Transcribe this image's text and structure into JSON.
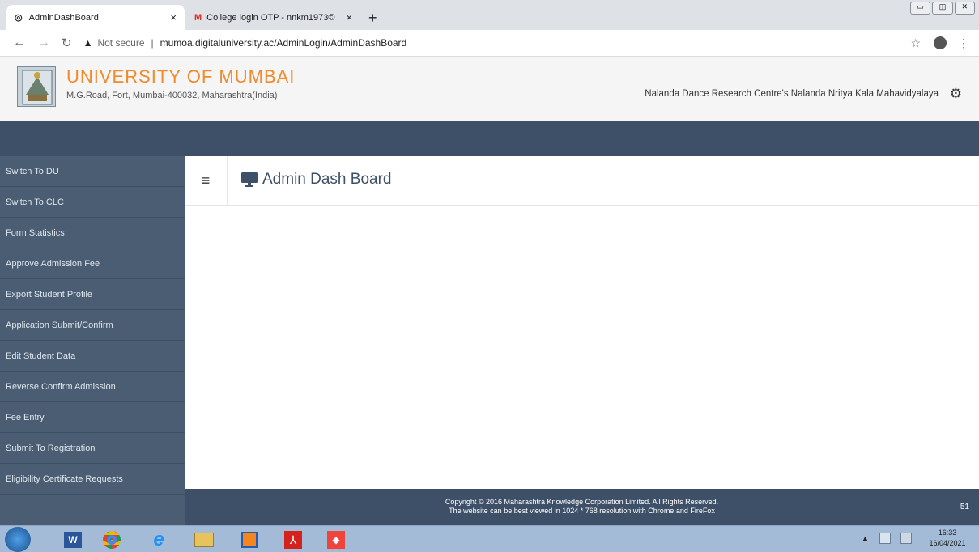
{
  "browser": {
    "tabs": [
      {
        "title": "AdminDashBoard",
        "close": "×"
      },
      {
        "title": "College login OTP - nnkm1973©",
        "close": "×"
      }
    ],
    "new_tab": "+",
    "address": {
      "security": "Not secure",
      "url": "mumoa.digitaluniversity.ac/AdminLogin/AdminDashBoard"
    }
  },
  "header": {
    "title": "UNIVERSITY OF MUMBAI",
    "address": "M.G.Road, Fort, Mumbai-400032, Maharashtra(India)",
    "college": "Nalanda Dance Research Centre's Nalanda Nritya Kala Mahavidyalaya"
  },
  "sidebar": {
    "items": [
      "Switch To DU",
      "Switch To CLC",
      "Form Statistics",
      "Approve Admission Fee",
      "Export Student Profile",
      "Application Submit/Confirm",
      "Edit Student Data",
      "Reverse Confirm Admission",
      "Fee Entry",
      "Submit To Registration",
      "Eligibility Certificate Requests"
    ]
  },
  "main": {
    "page_title": "Admin Dash Board"
  },
  "footer": {
    "copyright": "Copyright © 2016 Maharashtra Knowledge Corporation Limited. All Rights Reserved.",
    "note": "The website can be best viewed in 1024 * 768 resolution with Chrome and FireFox",
    "count": "51"
  },
  "taskbar": {
    "time": "16:33",
    "date": "16/04/2021"
  },
  "colors": {
    "accent": "#f08a2c",
    "sidebar": "#4a5d72",
    "band": "#3e5068"
  }
}
